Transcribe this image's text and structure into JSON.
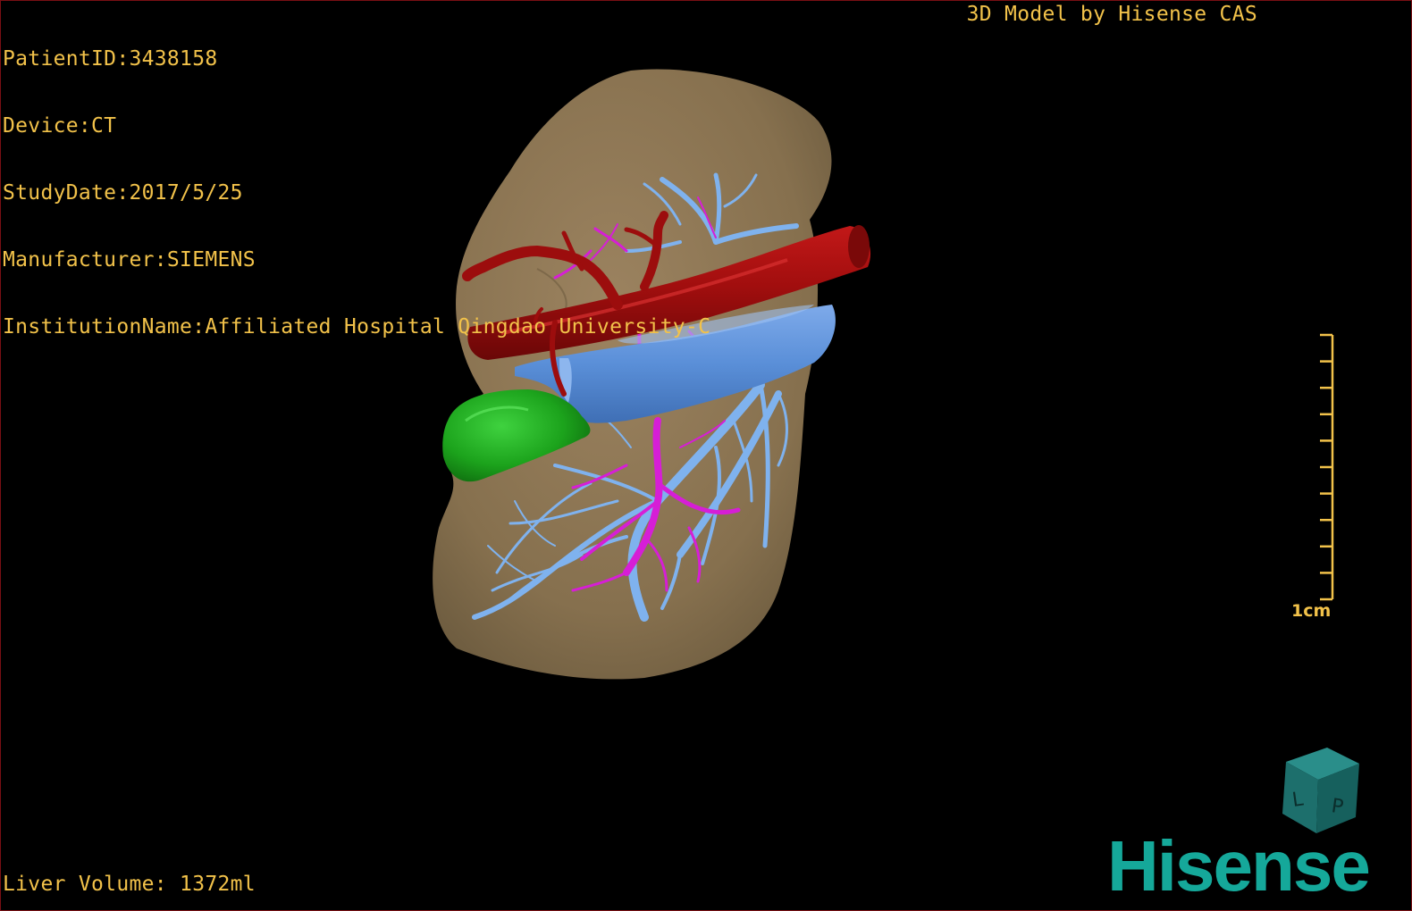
{
  "patient_info": {
    "patient_id": "PatientID:3438158",
    "device": "Device:CT",
    "study_date": "StudyDate:2017/5/25",
    "manufacturer": "Manufacturer:SIEMENS",
    "institution": "InstitutionName:Affiliated Hospital Qingdao University-C"
  },
  "credit": "3D Model by Hisense CAS",
  "liver_volume": "Liver Volume: 1372ml",
  "scale": {
    "label": "1cm",
    "ticks": 10
  },
  "brand": {
    "name": "Hisense",
    "color": "#15a89a"
  },
  "model": {
    "structures": [
      "liver",
      "inferior-vena-cava",
      "portal-vein",
      "hepatic-veins",
      "hepatic-artery",
      "gallbladder"
    ],
    "colors": {
      "liver": "#8a7150",
      "vena_cava": "#9c0d0d",
      "portal_vein": "#5f93d8",
      "hepatic_veins": "#7fb2ee",
      "artery": "#d61ed6",
      "gallbladder": "#1ca31c",
      "overlay_text": "#f2c24a"
    }
  },
  "orientation_cube": {
    "face_letters": [
      "L",
      "P"
    ]
  }
}
